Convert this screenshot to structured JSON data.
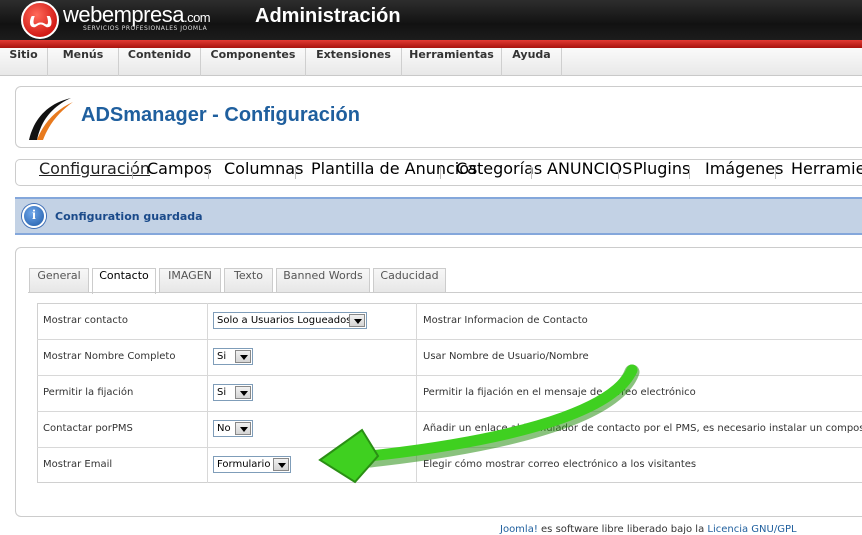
{
  "header": {
    "brand": "webempresa",
    "brand_suffix": ".com",
    "brand_sub": "SERVICIOS PROFESIONALES JOOMLA",
    "title": "Administración"
  },
  "menubar": [
    "Sitio",
    "Menús",
    "Contenido",
    "Componentes",
    "Extensiones",
    "Herramientas",
    "Ayuda"
  ],
  "page": {
    "title": "ADSmanager - Configuración"
  },
  "subnav": [
    "Configuración",
    "Campos",
    "Columnas",
    "Plantilla de Anuncios",
    "Categorías",
    "ANUNCIOS",
    "Plugins",
    "Imágenes",
    "Herramientas"
  ],
  "message": "Configuration guardada",
  "tabs": [
    "General",
    "Contacto",
    "IMAGEN",
    "Texto",
    "Banned Words",
    "Caducidad"
  ],
  "active_tab": "Contacto",
  "rows": [
    {
      "label": "Mostrar contacto",
      "value": "Solo a Usuarios Logueados",
      "desc": "Mostrar Informacion de Contacto"
    },
    {
      "label": "Mostrar Nombre Completo",
      "value": "Si",
      "desc": "Usar Nombre de Usuario/Nombre"
    },
    {
      "label": "Permitir la fijación",
      "value": "Si",
      "desc": "Permitir la fijación en el mensaje de correo electrónico"
    },
    {
      "label": "Contactar porPMS",
      "value": "No",
      "desc": "Añadir un enlace al formulador de contacto por el PMS, es necesario instalar un composante"
    },
    {
      "label": "Mostrar Email",
      "value": "Formulario",
      "desc": "Elegir cómo mostrar correo electrónico a los visitantes"
    }
  ],
  "footer": {
    "link1": "Joomla!",
    "text": " es software libre liberado bajo la ",
    "link2": "Licencia GNU/GPL"
  },
  "colors": {
    "accent": "#1f5f9e",
    "header_bg": "#1c1c1c",
    "red_strip": "#d3221c",
    "message_bg": "#c3d2e5",
    "arrow": "#3cc81e"
  }
}
